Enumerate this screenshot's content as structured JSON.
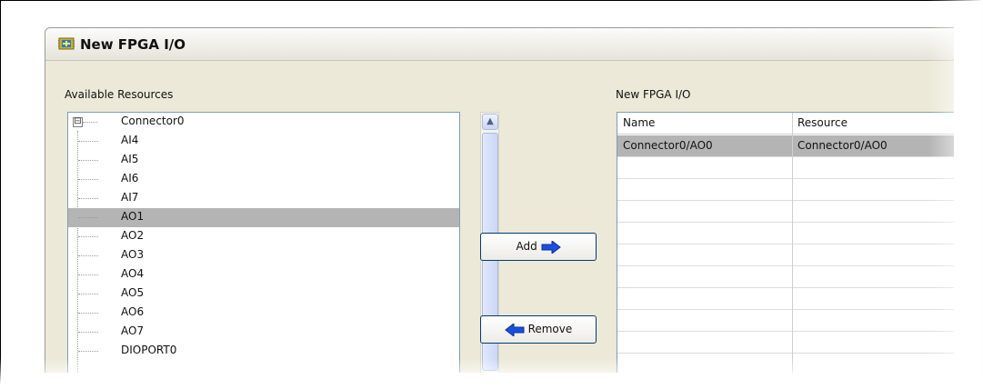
{
  "window": {
    "title": "New FPGA I/O"
  },
  "left_panel": {
    "label": "Available Resources",
    "root": {
      "label": "Connector0",
      "expander": "⊟"
    },
    "items": [
      {
        "label": "AI4"
      },
      {
        "label": "AI5"
      },
      {
        "label": "AI6"
      },
      {
        "label": "AI7"
      },
      {
        "label": "AO1",
        "selected": true
      },
      {
        "label": "AO2"
      },
      {
        "label": "AO3"
      },
      {
        "label": "AO4"
      },
      {
        "label": "AO5"
      },
      {
        "label": "AO6"
      },
      {
        "label": "AO7"
      },
      {
        "label": "DIOPORT0"
      }
    ]
  },
  "buttons": {
    "add_label": "Add",
    "add_icon": "right-arrow-icon",
    "remove_label": "Remove",
    "remove_icon": "left-arrow-icon",
    "arrow_color": "#1a4fe0"
  },
  "right_panel": {
    "label": "New FPGA I/O",
    "columns": [
      "Name",
      "Resource"
    ],
    "rows": [
      {
        "name": "Connector0/AO0",
        "resource": "Connector0/AO0",
        "selected": true
      }
    ]
  }
}
